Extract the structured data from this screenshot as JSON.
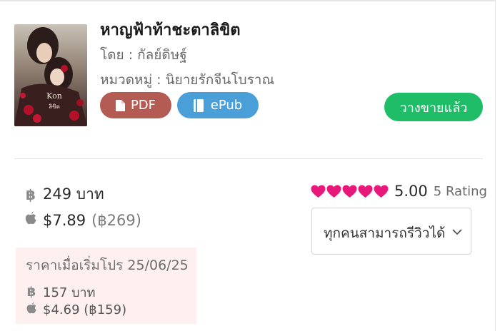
{
  "book": {
    "title": "หาญฟ้าท้าชะตาลิขิต",
    "author": "โดย : กัลย์ดิษฐ์",
    "category": "หมวดหมู่ : นิยายรักจีนโบราณ",
    "cover_icon": "book-cover-image"
  },
  "formats": [
    {
      "label": "PDF",
      "icon": "file-icon",
      "color": "#b45b54"
    },
    {
      "label": "ePub",
      "icon": "book-icon",
      "color": "#4a9fd8"
    }
  ],
  "sale_status": {
    "label": "วางขายแล้ว",
    "color": "#1fbd68"
  },
  "price": {
    "thb_icon": "฿",
    "thb": "249 บาท",
    "usd_icon": "apple-icon",
    "usd": "$7.89",
    "usd_thb": "(฿269)"
  },
  "promo": {
    "title": "ราคาเมื่อเริ่มโปร 25/06/25",
    "thb_icon": "฿",
    "thb": "157 บาท",
    "usd": "$4.69 (฿159)"
  },
  "rating": {
    "score": "5.00",
    "count": "5 Rating",
    "hearts": 5,
    "heart_color": "#e8177a"
  },
  "review_dropdown": {
    "selected": "ทุกคนสามารถรีวิวได้"
  }
}
